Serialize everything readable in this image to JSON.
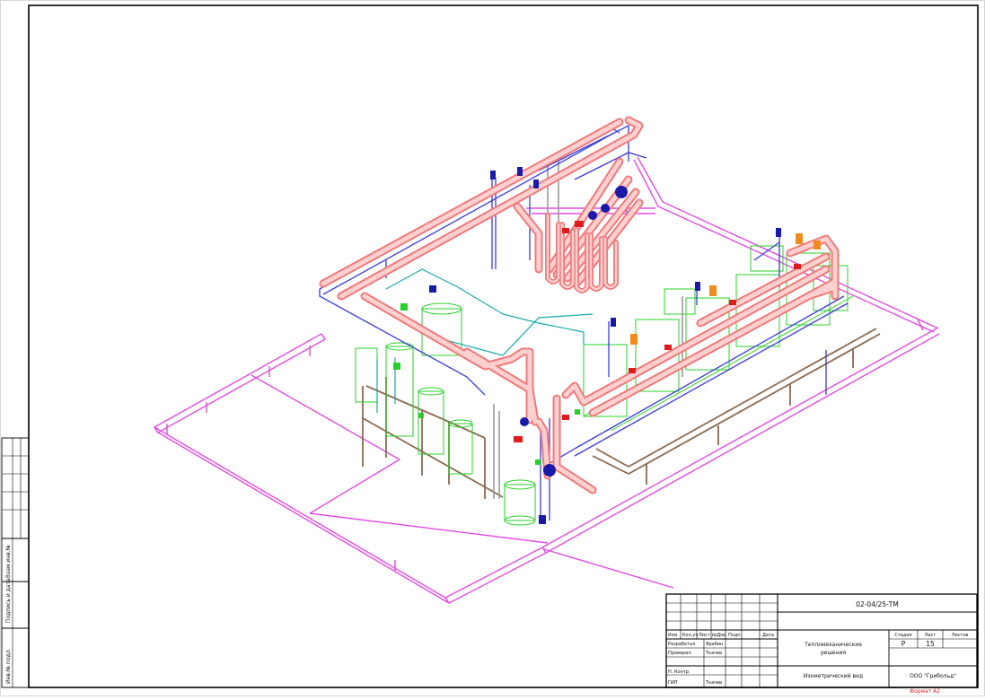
{
  "title_block": {
    "doc_code": "02-04/25-ТМ",
    "section": "Тепломеханические решения",
    "section_line1": "Тепломеханические",
    "section_line2": "решения",
    "sheet_title": "Изометрический вид",
    "company": "ООО \"Грибольд\"",
    "stage_label": "Стадия",
    "sheet_label": "Лист",
    "sheets_label": "Листов",
    "stage_value": "Р",
    "sheet_value": "15",
    "sheets_value": "",
    "columns": [
      "Изм.",
      "Кол.уч",
      "Лист",
      "№Док.",
      "Подп.",
      "Дата"
    ],
    "roles": [
      {
        "role": "Разработал",
        "name": "Ярабин"
      },
      {
        "role": "Проверил",
        "name": "Ткачев"
      },
      {
        "role": "",
        "name": ""
      },
      {
        "role": "",
        "name": ""
      },
      {
        "role": "Н. Контр.",
        "name": ""
      },
      {
        "role": "ГИП",
        "name": "Ткачев"
      }
    ]
  },
  "side_stamp": [
    "Инв.№ подл.",
    "Подпись и дата",
    "Взам.инв.№"
  ],
  "format_label": "Формат А2",
  "colors": {
    "frame": "#000000",
    "hot_pipe": "#f07a7a",
    "hot_pipe_inner": "#ffd0d0",
    "cold_pipe": "#3b3bd6",
    "platform": "#e34ce0",
    "equipment": "#27d127",
    "cyan_line": "#16a8a8",
    "brown_pipe": "#8a6a50",
    "valve_red": "#e01b1b",
    "valve_blue": "#1a1aa8",
    "valve_orange": "#f08a1a",
    "grey": "#9a9a9a"
  }
}
